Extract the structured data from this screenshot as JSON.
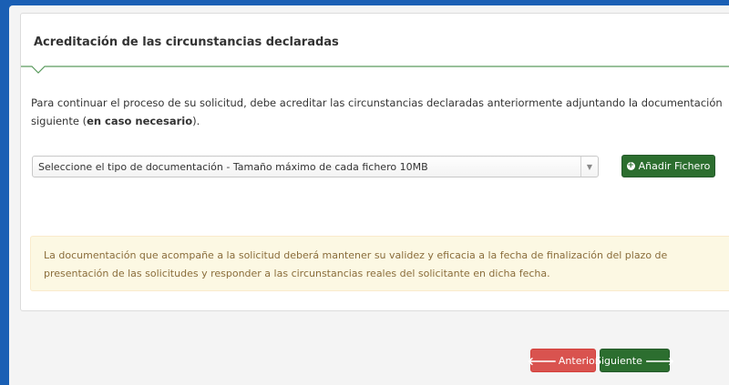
{
  "panel": {
    "title": "Acreditación de las circunstancias declaradas",
    "intro_text": "Para continuar el proceso de su solicitud, debe acreditar las circunstancias declaradas anteriormente adjuntando la documentación siguiente (",
    "intro_bold": "en caso necesario",
    "intro_end": ")."
  },
  "document_select": {
    "selected": "Seleccione el tipo de documentación - Tamaño máximo de cada fichero 10MB"
  },
  "add_button": {
    "label": "Añadir Fichero",
    "icon": "plus-circle-icon"
  },
  "warning": {
    "text": "La documentación que acompañe a la solicitud deberá mantener su validez y eficacia a la fecha de finalización del plazo de presentación de las solicitudes y responder a las circunstancias reales del solicitante en dicha fecha."
  },
  "navigation": {
    "prev_label": "Anterior",
    "next_label": "Siguiente"
  },
  "colors": {
    "primary_green": "#2c6e2f",
    "danger_red": "#d9534f",
    "warning_bg": "#fcf8e3",
    "warning_text": "#8a6d3b",
    "frame_blue": "#1a5fb4"
  }
}
